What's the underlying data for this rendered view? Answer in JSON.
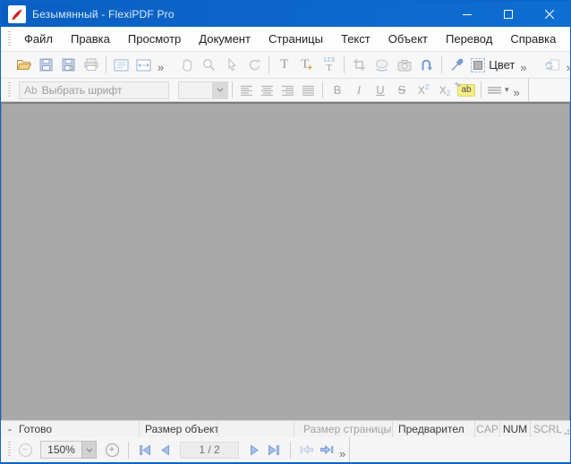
{
  "window": {
    "title": "Безымянный - FlexiPDF Pro"
  },
  "menu": {
    "items": [
      "Файл",
      "Правка",
      "Просмотр",
      "Документ",
      "Страницы",
      "Текст",
      "Объект",
      "Перевод",
      "Справка"
    ]
  },
  "toolbar_main": {
    "color_label": "Цвет",
    "text_tool": "T",
    "add_text_tool": "T",
    "add_text_plus": "+",
    "numbering_top": "123",
    "numbering_base": "T"
  },
  "toolbar_format": {
    "font_prefix": "Ab",
    "font_placeholder": "Выбрать шрифт",
    "bold": "B",
    "italic": "I",
    "underline": "U",
    "strikethrough": "S",
    "superscript_base": "X",
    "superscript_mark": "2",
    "subscript_base": "X",
    "subscript_mark": "2",
    "highlight": "ab"
  },
  "icons": {
    "overflow_chevron": "»",
    "dropdown_arrow": "▾",
    "app_logo": "flexipdf-red-swoosh",
    "open": "folder-open-icon",
    "save": "floppy-icon",
    "print": "printer-icon",
    "hand": "hand-tool-icon",
    "zoom": "magnifier-icon",
    "select": "cursor-icon",
    "color": "color-swatch-icon"
  },
  "statusbar": {
    "prefix_dash": "-",
    "ready": "Готово",
    "object_size_label": "Размер объект",
    "page_size_label": "Размер страницы",
    "preview_label": "Предварител",
    "caps_indicator": "CAP",
    "num_indicator": "NUM",
    "scroll_indicator": "SCRL"
  },
  "bottom_toolbar": {
    "zoom_value": "150%",
    "page_indicator": "1 / 2"
  },
  "colors": {
    "titlebar_blue": "#0c66cb",
    "accent_blue": "#0e64c8",
    "icon_blue": "#6f93d6",
    "folder_yellow": "#f0d084",
    "highlight_yellow": "#f5ee86",
    "document_background": "#a9a9a9",
    "toolbar_background": "#f7f7f7"
  }
}
